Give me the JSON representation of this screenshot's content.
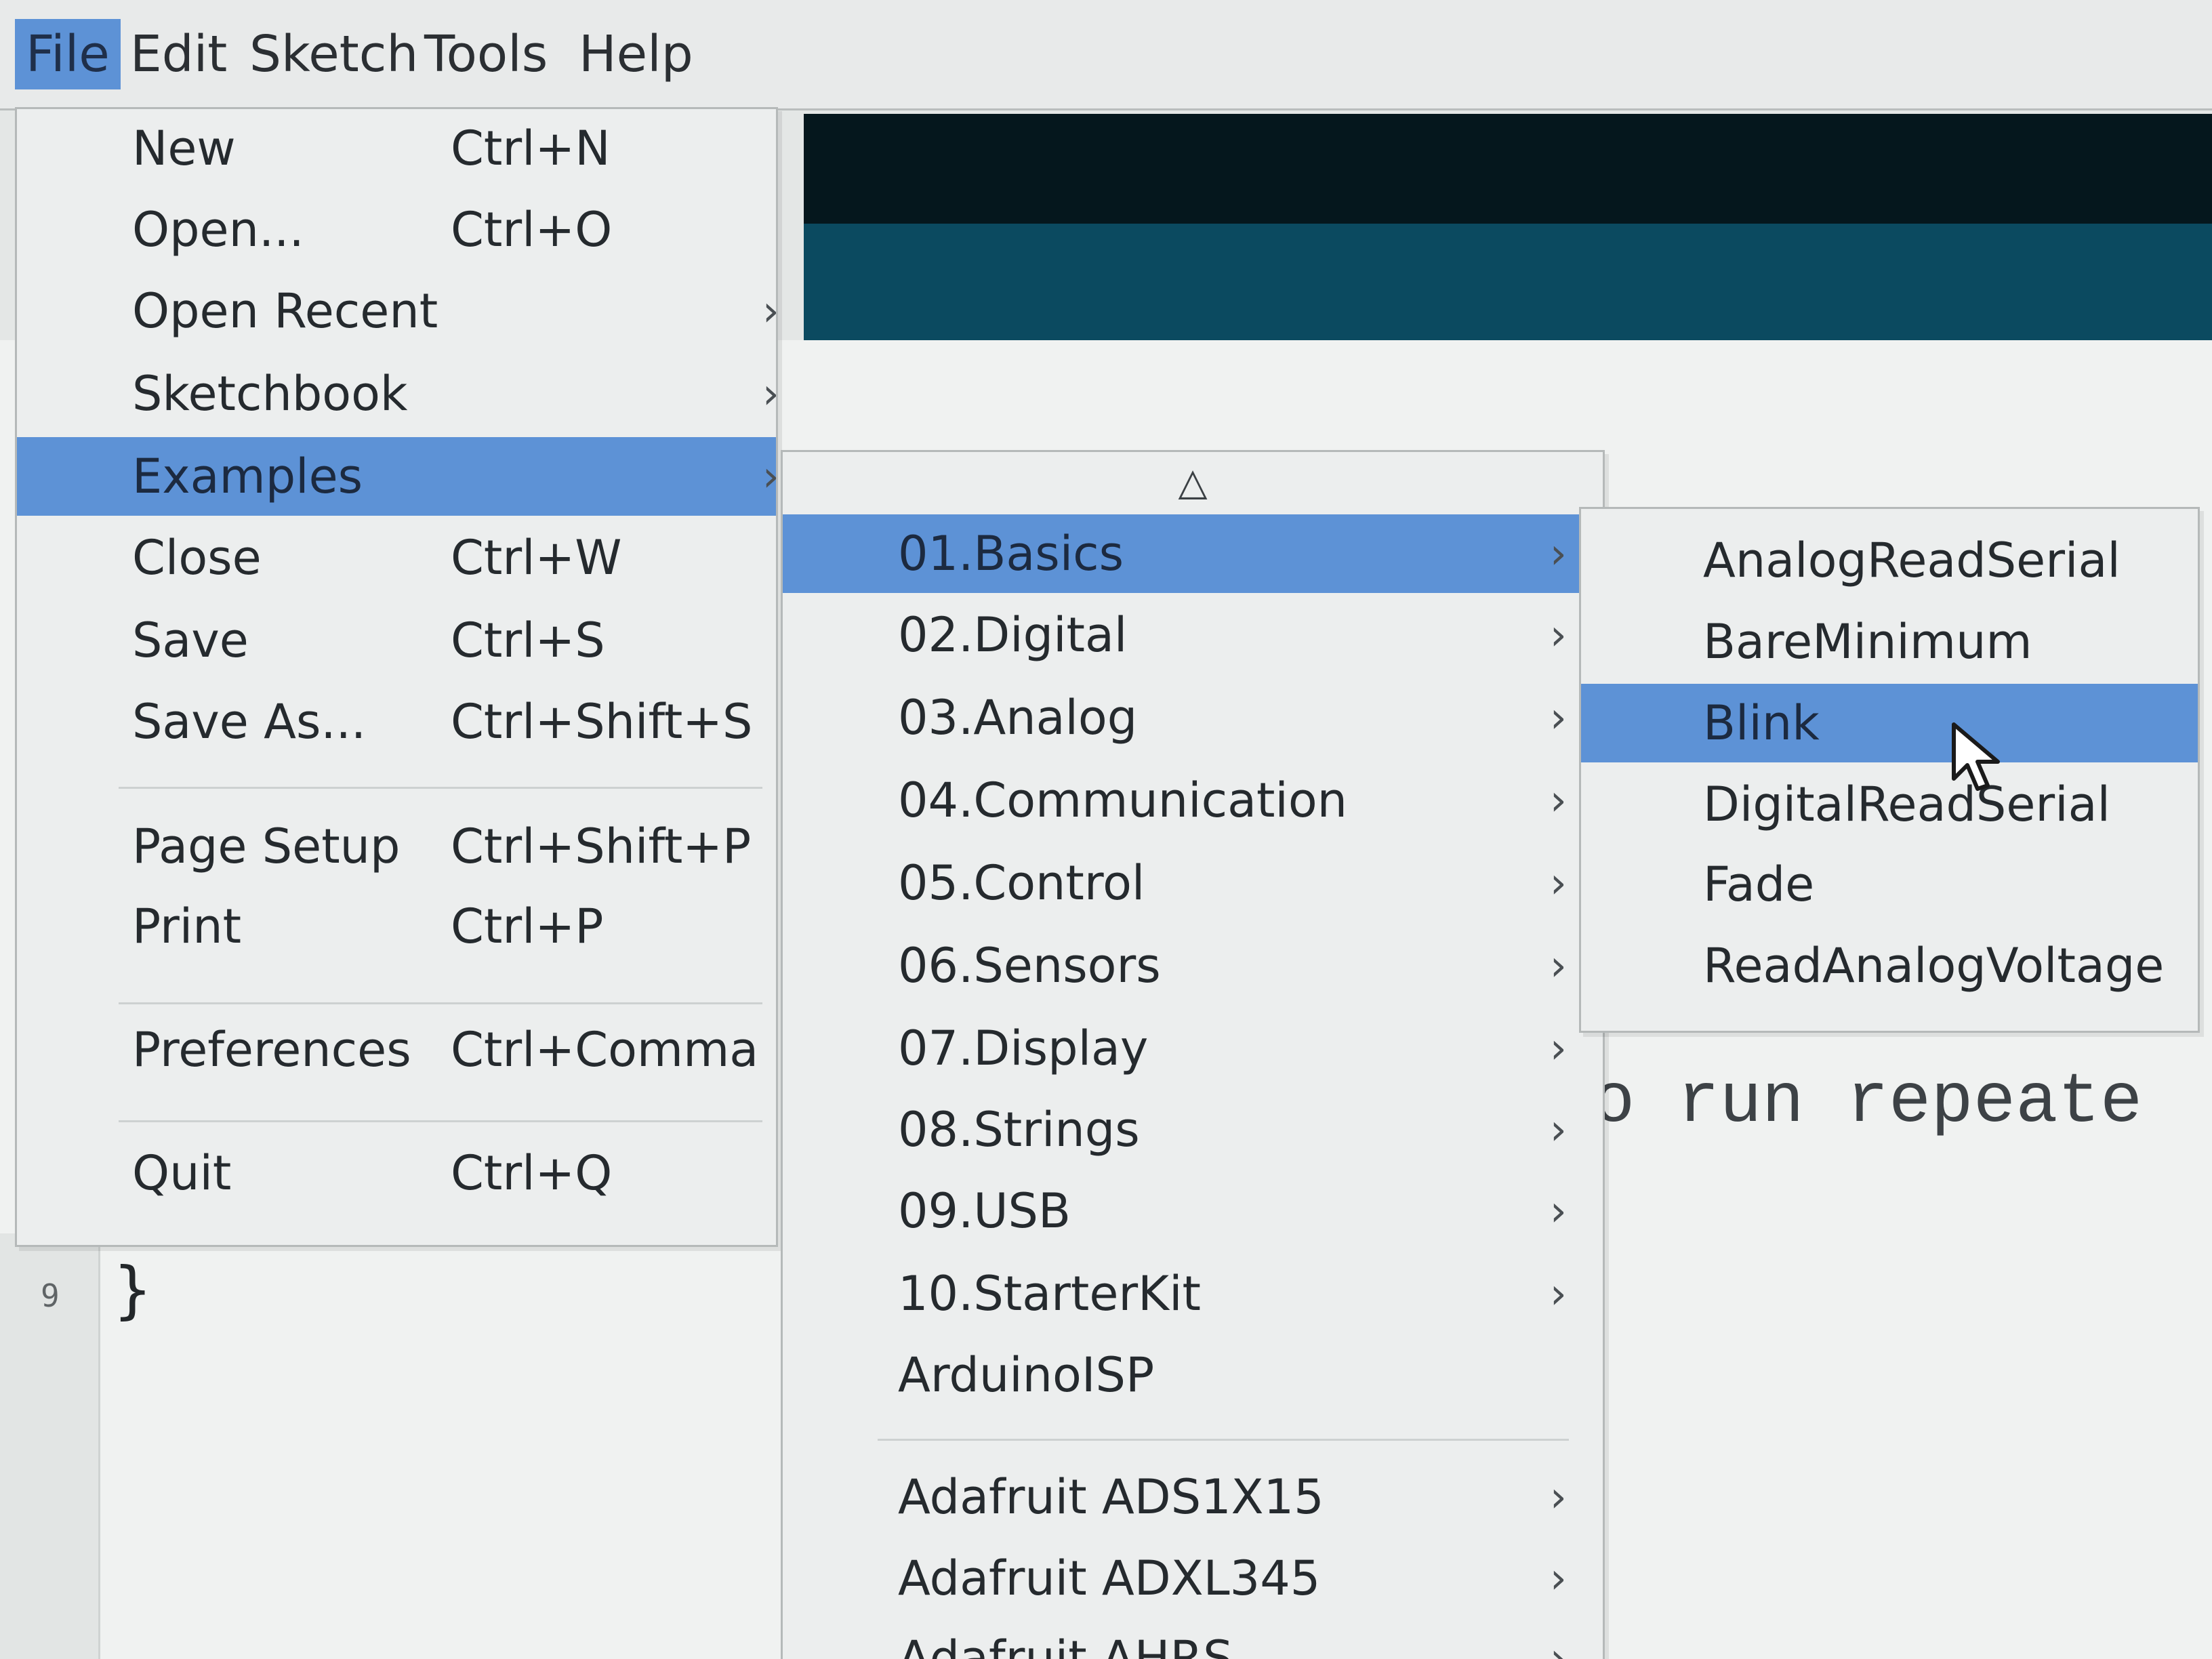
{
  "menubar": {
    "items": [
      "File",
      "Edit",
      "Sketch",
      "Tools",
      "Help"
    ]
  },
  "editor": {
    "line_number": "9",
    "brace": "}",
    "comment_fragment": "o run repeate"
  },
  "file_menu": {
    "items": [
      {
        "label": "New",
        "shortcut": "Ctrl+N"
      },
      {
        "label": "Open...",
        "shortcut": "Ctrl+O"
      },
      {
        "label": "Open Recent",
        "shortcut": ""
      },
      {
        "label": "Sketchbook",
        "shortcut": ""
      },
      {
        "label": "Examples",
        "shortcut": ""
      },
      {
        "label": "Close",
        "shortcut": "Ctrl+W"
      },
      {
        "label": "Save",
        "shortcut": "Ctrl+S"
      },
      {
        "label": "Save As...",
        "shortcut": "Ctrl+Shift+S"
      },
      {
        "label": "Page Setup",
        "shortcut": "Ctrl+Shift+P"
      },
      {
        "label": "Print",
        "shortcut": "Ctrl+P"
      },
      {
        "label": "Preferences",
        "shortcut": "Ctrl+Comma"
      },
      {
        "label": "Quit",
        "shortcut": "Ctrl+Q"
      }
    ]
  },
  "examples_menu": {
    "scroll_up_icon": "triangle-up-icon",
    "items": [
      "01.Basics",
      "02.Digital",
      "03.Analog",
      "04.Communication",
      "05.Control",
      "06.Sensors",
      "07.Display",
      "08.Strings",
      "09.USB",
      "10.StarterKit",
      "ArduinoISP",
      "Adafruit ADS1X15",
      "Adafruit ADXL345",
      "Adafruit AHRS"
    ]
  },
  "basics_menu": {
    "items": [
      "AnalogReadSerial",
      "BareMinimum",
      "Blink",
      "DigitalReadSerial",
      "Fade",
      "ReadAnalogVoltage"
    ]
  },
  "colors": {
    "highlight": "#5d92d6",
    "toolbar_dark": "#05171d",
    "toolbar_teal": "#0b4a60",
    "menu_bg": "#eceeee"
  }
}
